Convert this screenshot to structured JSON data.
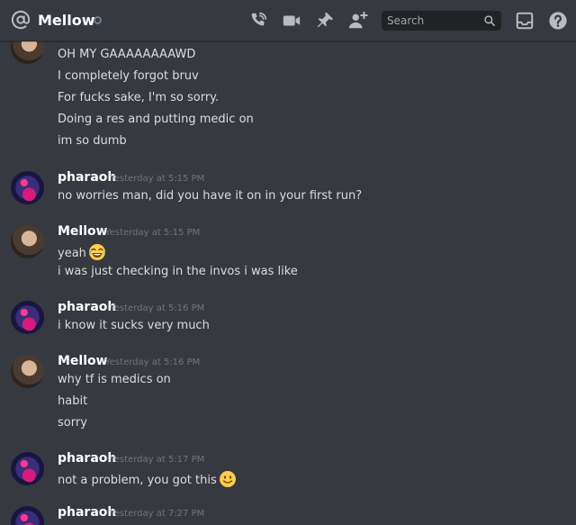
{
  "header": {
    "channel_name": "Mellow",
    "search_placeholder": "Search",
    "icons": [
      "at-icon",
      "call-icon",
      "video-icon",
      "pin-icon",
      "add-member-icon",
      "search-icon",
      "inbox-icon",
      "help-icon"
    ]
  },
  "messages": {
    "group0": {
      "lines": [
        "OH MY GAAAAAAAAWD",
        "I completely forgot bruv",
        "For fucks sake, I'm so sorry.",
        "Doing a res and putting medic on",
        "im so dumb"
      ]
    },
    "group1": {
      "author": "pharaoh",
      "timestamp": "Yesterday at 5:15 PM",
      "lines": [
        "no worries man, did you have it on in your first run?"
      ]
    },
    "group2": {
      "author": "Mellow",
      "timestamp": "Yesterday at 5:15 PM",
      "lines": [
        "yeah",
        "i was just checking in the invos i was like"
      ],
      "emoji": "joy-emoji"
    },
    "group3": {
      "author": "pharaoh",
      "timestamp": "Yesterday at 5:16 PM",
      "lines": [
        "i know it sucks very much"
      ]
    },
    "group4": {
      "author": "Mellow",
      "timestamp": "Yesterday at 5:16 PM",
      "lines": [
        "why tf is medics on",
        "habit",
        "sorry"
      ]
    },
    "group5": {
      "author": "pharaoh",
      "timestamp": "Yesterday at 5:17 PM",
      "lines": [
        "not a problem, you got this"
      ],
      "emoji": "slight-smile-emoji"
    },
    "group6": {
      "author": "pharaoh",
      "timestamp": "Yesterday at 7:27 PM"
    }
  }
}
